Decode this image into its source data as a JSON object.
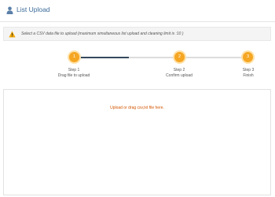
{
  "header": {
    "title": "List Upload",
    "icon": "user-icon"
  },
  "notice": {
    "icon": "warning-icon",
    "text": "Select a CSV data file to upload (maximum simultaneous list upload and cleaning limit is :10 )"
  },
  "steps": [
    {
      "number": "1",
      "title": "Step 1",
      "subtitle": "Drag file to upload"
    },
    {
      "number": "2",
      "title": "Step 2",
      "subtitle": "Confirm upload"
    },
    {
      "number": "3",
      "title": "Step 3",
      "subtitle": "Finish"
    }
  ],
  "progress": {
    "completed_fraction": 0.33
  },
  "dropzone": {
    "text": "Upload or drag csv,txt file here."
  },
  "colors": {
    "accent": "#f5a623",
    "title": "#3a6a98",
    "drop_text": "#d35400",
    "track_done": "#34495e",
    "track_todo": "#dcdcdc"
  }
}
